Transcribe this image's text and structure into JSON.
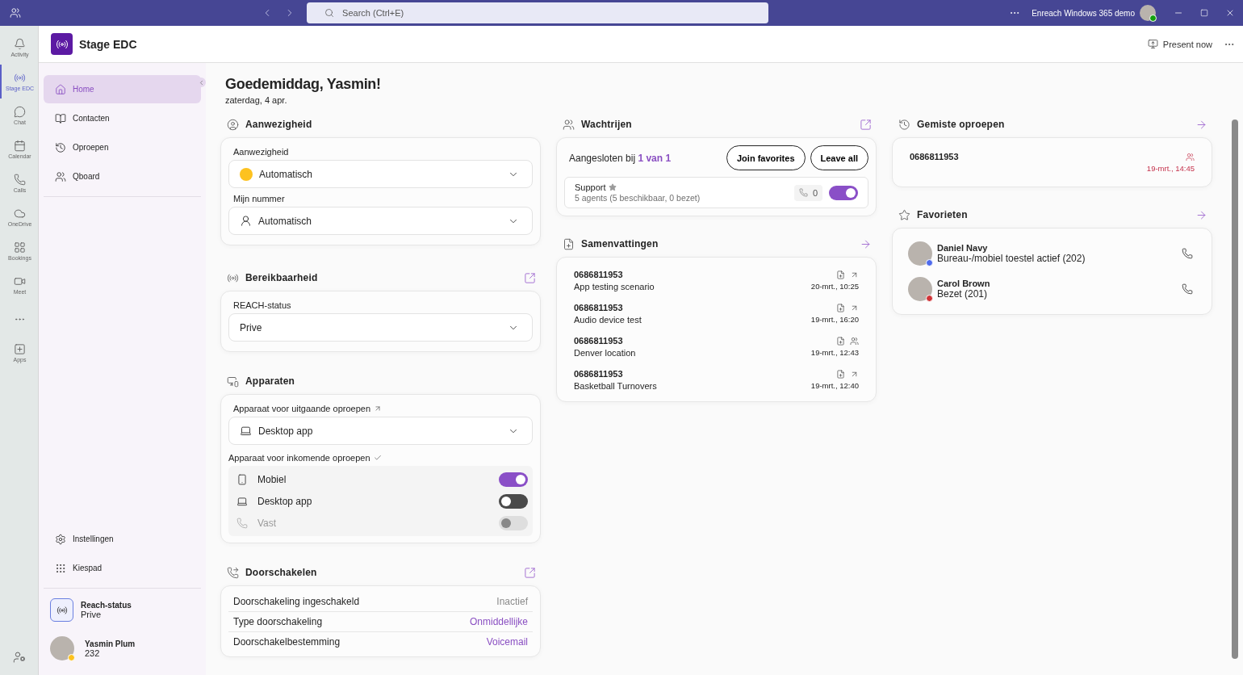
{
  "titlebar": {
    "search_placeholder": "Search (Ctrl+E)",
    "account": "Enreach Windows 365 demo"
  },
  "rail": {
    "items": [
      {
        "label": "Activity",
        "selected": false
      },
      {
        "label": "Stage EDC",
        "selected": true
      },
      {
        "label": "Chat",
        "selected": false
      },
      {
        "label": "Calendar",
        "selected": false
      },
      {
        "label": "Calls",
        "selected": false
      },
      {
        "label": "OneDrive",
        "selected": false
      },
      {
        "label": "Bookings",
        "selected": false
      },
      {
        "label": "Meet",
        "selected": false
      }
    ],
    "apps": "Apps"
  },
  "app": {
    "title": "Stage EDC",
    "present": "Present now"
  },
  "nav": {
    "items": [
      {
        "label": "Home",
        "selected": true
      },
      {
        "label": "Contacten",
        "selected": false
      },
      {
        "label": "Oproepen",
        "selected": false
      },
      {
        "label": "Qboard",
        "selected": false
      }
    ],
    "bottom_items": [
      {
        "label": "Instellingen"
      },
      {
        "label": "Kiespad"
      }
    ],
    "reach": {
      "label": "Reach-status",
      "value": "Prive"
    },
    "user": {
      "name": "Yasmin Plum",
      "extension": "232"
    }
  },
  "greeting": "Goedemiddag, Yasmin!",
  "date": "zaterdag, 4 apr.",
  "presence": {
    "title": "Aanwezigheid",
    "fields": [
      {
        "label": "Aanwezigheid",
        "value": "Automatisch",
        "kind": "status"
      },
      {
        "label": "Mijn nummer",
        "value": "Automatisch",
        "kind": "person"
      }
    ]
  },
  "reachability": {
    "title": "Bereikbaarheid",
    "label": "REACH-status",
    "value": "Prive"
  },
  "devices": {
    "title": "Apparaten",
    "outgoing_label": "Apparaat voor uitgaande oproepen",
    "outgoing_value": "Desktop app",
    "incoming_label": "Apparaat voor inkomende oproepen",
    "incoming": [
      {
        "label": "Mobiel",
        "kind": "mobile",
        "on": true,
        "disabled": false
      },
      {
        "label": "Desktop app",
        "kind": "desktop",
        "on": false,
        "disabled": false
      },
      {
        "label": "Vast",
        "kind": "deskphone",
        "on": false,
        "disabled": true
      }
    ]
  },
  "forwarding": {
    "title": "Doorschakelen",
    "rows": [
      {
        "label": "Doorschakeling ingeschakeld",
        "value": "Inactief",
        "active": false
      },
      {
        "label": "Type doorschakeling",
        "value": "Onmiddellijke",
        "active": true
      },
      {
        "label": "Doorschakelbestemming",
        "value": "Voicemail",
        "active": true
      }
    ]
  },
  "queues": {
    "title": "Wachtrijen",
    "joined_label": "Aangesloten bij",
    "joined_value": "1 van 1",
    "buttons": [
      "Join favorites",
      "Leave all"
    ],
    "items": [
      {
        "name": "Support",
        "favorite": true,
        "detail": "5 agents (5 beschikbaar, 0 bezet)",
        "calls": "0",
        "on": true
      }
    ]
  },
  "summaries": {
    "title": "Samenvattingen",
    "items": [
      {
        "number": "0686811953",
        "subject": "App testing scenario",
        "time": "20-mrt., 10:25",
        "kind": "outgoing"
      },
      {
        "number": "0686811953",
        "subject": "Audio device test",
        "time": "19-mrt., 16:20",
        "kind": "outgoing"
      },
      {
        "number": "0686811953",
        "subject": "Denver location",
        "time": "19-mrt., 12:43",
        "kind": "queue"
      },
      {
        "number": "0686811953",
        "subject": "Basketball Turnovers",
        "time": "19-mrt., 12:40",
        "kind": "outgoing"
      }
    ]
  },
  "missed": {
    "title": "Gemiste oproepen",
    "items": [
      {
        "number": "0686811953",
        "time": "19-mrt., 14:45",
        "kind": "queue"
      }
    ]
  },
  "favorites": {
    "title": "Favorieten",
    "items": [
      {
        "name": "Daniel Navy",
        "status": "Bureau-/mobiel toestel actief (202)",
        "color": "#4f6bed"
      },
      {
        "name": "Carol Brown",
        "status": "Bezet (201)",
        "color": "#d13438"
      }
    ]
  }
}
